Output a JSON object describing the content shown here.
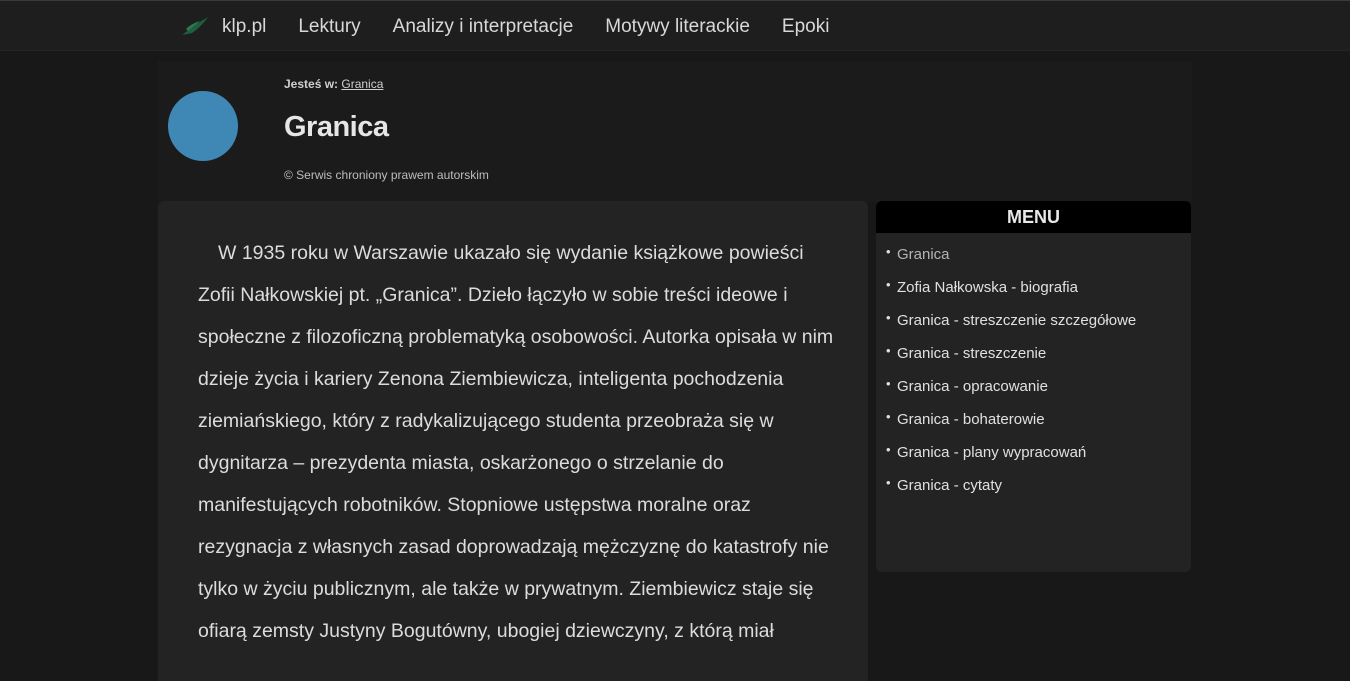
{
  "nav": {
    "logo_icon": "bird-logo-icon",
    "brand": "klp.pl",
    "links": [
      "Lektury",
      "Analizy i interpretacje",
      "Motywy literackie",
      "Epoki"
    ]
  },
  "header": {
    "breadcrumb_label": "Jesteś w:",
    "breadcrumb_link": "Granica",
    "title": "Granica",
    "copyright": "© Serwis chroniony prawem autorskim",
    "avatar_color": "#3f88b6"
  },
  "article": {
    "text": "W 1935 roku w Warszawie ukazało się wydanie książkowe powieści Zofii Nałkowskiej pt. „Granica”. Dzieło łączyło w sobie treści ideowe i społeczne z filozoficzną problematyką osobowości. Autorka opisała w nim dzieje życia i kariery Zenona Ziembiewicza, inteligenta pochodzenia ziemiańskiego, który z radykalizującego studenta przeobraża się w dygnitarza – prezydenta miasta, oskarżonego o strzelanie do manifestujących robotników. Stopniowe ustępstwa moralne oraz rezygnacja z własnych zasad doprowadzają mężczyznę do katastrofy nie tylko w życiu publicznym, ale także w prywatnym. Ziembiewicz staje się ofiarą zemsty Justyny Bogutówny, ubogiej dziewczyny, z którą miał"
  },
  "menu": {
    "title": "MENU",
    "items": [
      "Granica",
      "Zofia Nałkowska - biografia",
      "Granica - streszczenie szczegółowe",
      "Granica - streszczenie",
      "Granica - opracowanie",
      "Granica - bohaterowie",
      "Granica - plany wypracowań",
      "Granica - cytaty"
    ]
  }
}
